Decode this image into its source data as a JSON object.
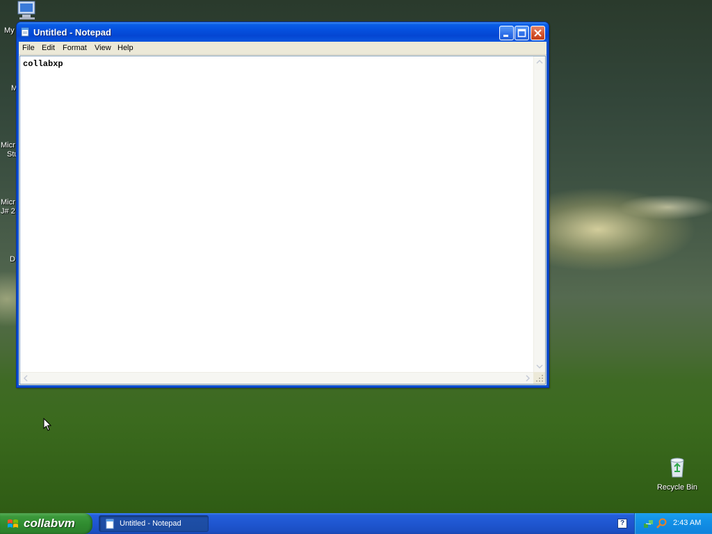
{
  "desktop": {
    "icons": [
      {
        "label": "My",
        "icon": "computer-icon"
      },
      {
        "label": "M"
      },
      {
        "label": "Micr"
      },
      {
        "label": "Stu"
      },
      {
        "label": "Micr"
      },
      {
        "label": "J# 2"
      },
      {
        "label": "D"
      },
      {
        "label": "Recycle Bin",
        "icon": "recycle-bin-icon"
      }
    ]
  },
  "window": {
    "title": "Untitled - Notepad",
    "app_icon": "notepad-icon",
    "menu": [
      "File",
      "Edit",
      "Format",
      "View",
      "Help"
    ],
    "content": "collabxp"
  },
  "taskbar": {
    "start_label": "collabvm",
    "tasks": [
      {
        "label": "Untitled - Notepad",
        "icon": "notepad-icon"
      }
    ],
    "help_glyph": "?",
    "clock": "2:43 AM"
  },
  "colors": {
    "titlebar": "#0550de",
    "taskbar": "#245edb",
    "start_button": "#3c9a3c",
    "tray": "#1290e6"
  }
}
